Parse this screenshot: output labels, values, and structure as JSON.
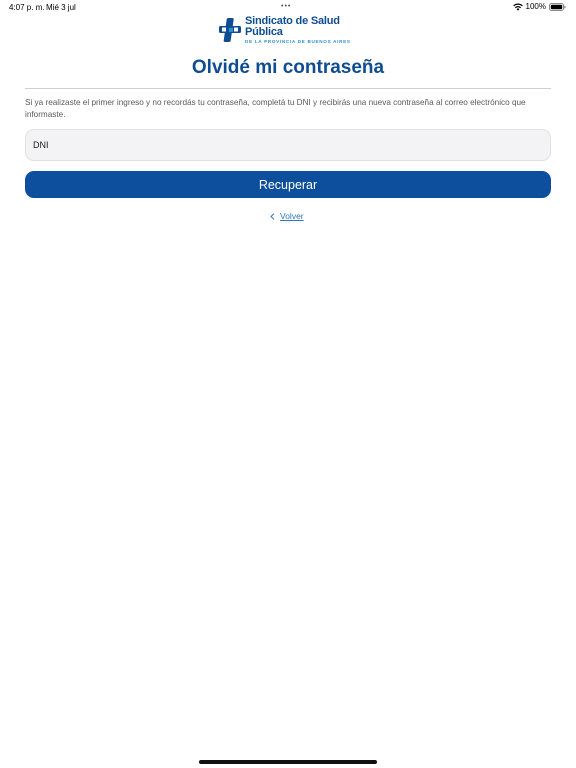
{
  "status_bar": {
    "time": "4:07 p. m.",
    "date": "Mié 3 jul",
    "dots": "•••",
    "battery": "100%"
  },
  "logo": {
    "title": "Sindicato de Salud Pública",
    "subtitle": "DE LA PROVINCIA DE BUENOS AIRES"
  },
  "page": {
    "title": "Olvidé mi contraseña",
    "description": "Si ya realizaste el primer ingreso y no recordás tu contraseña, completá tu DNI y recibirás una nueva contraseña al correo electrónico que informaste."
  },
  "form": {
    "dni_placeholder": "DNI",
    "dni_value": "",
    "recover_label": "Recuperar",
    "back_label": "Volver"
  },
  "colors": {
    "brand_primary": "#0d4f9c",
    "brand_title": "#0f4d92",
    "link": "#2f76c0",
    "logo_accent": "#2b8fd0"
  },
  "icons": {
    "wifi": "wifi-icon",
    "battery": "battery-icon",
    "logo": "logo-mark-icon",
    "back": "chevron-left-icon"
  }
}
